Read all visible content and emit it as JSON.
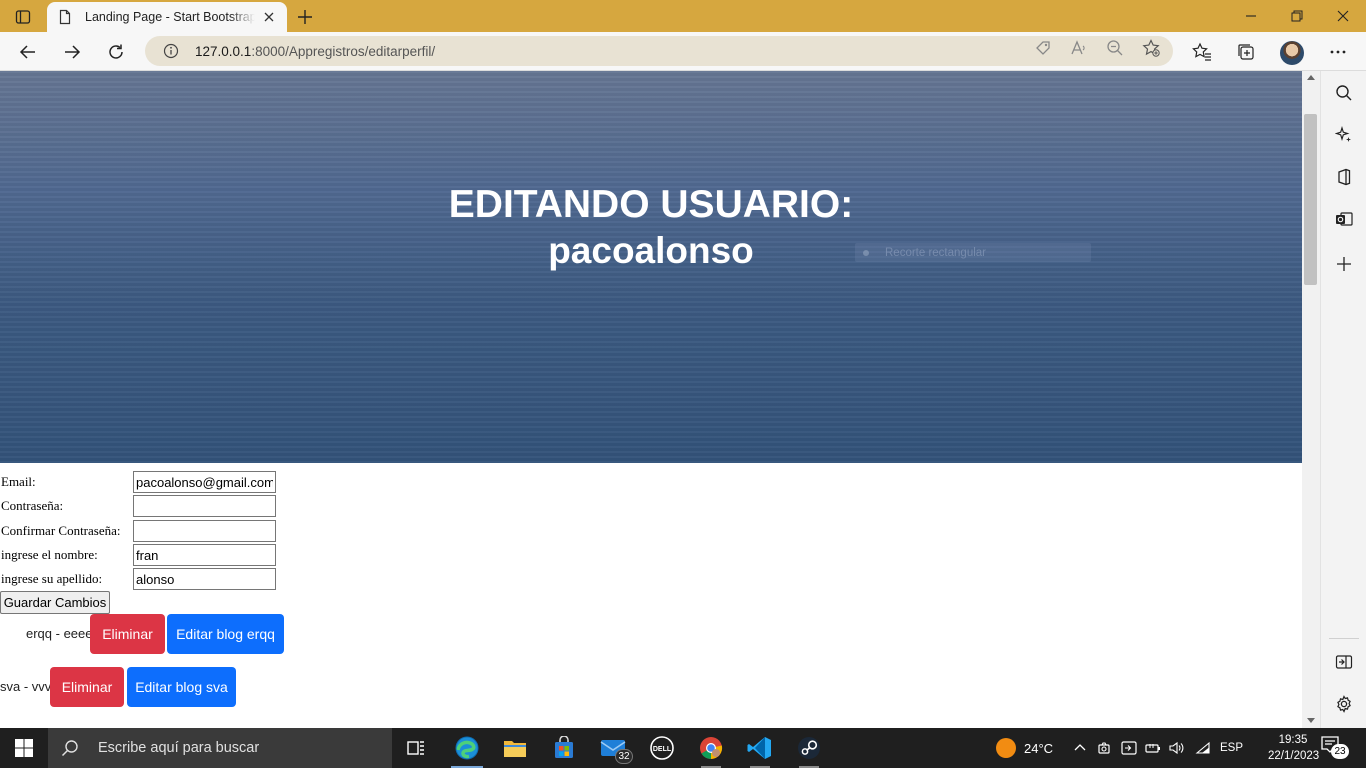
{
  "browser": {
    "tab_title": "Landing Page - Start Bootstrap Theme",
    "url_host": "127.0.0.1",
    "url_rest": ":8000/Appregistros/editarperfil/"
  },
  "page": {
    "hero_title": "EDITANDO USUARIO:",
    "hero_username": "pacoalonso",
    "snip_hint": "Recorte rectangular",
    "form": {
      "email_label": "Email:",
      "email_value": "pacoalonso@gmail.com",
      "password_label": "Contraseña:",
      "password_value": "",
      "confirm_label": "Confirmar Contraseña:",
      "confirm_value": "",
      "name_label": "ingrese el nombre:",
      "name_value": "fran",
      "lastname_label": "ingrese su apellido:",
      "lastname_value": "alonso",
      "save_label": "Guardar Cambios"
    },
    "blogs": [
      {
        "label": "erqq - eeee",
        "delete_label": "Eliminar",
        "edit_label": "Editar blog erqq"
      },
      {
        "label": "sva - vvv",
        "delete_label": "Eliminar",
        "edit_label": "Editar blog sva"
      }
    ]
  },
  "taskbar": {
    "search_placeholder": "Escribe aquí para buscar",
    "mail_badge": "32",
    "weather": "24°C",
    "language": "ESP",
    "time": "19:35",
    "date": "22/1/2023",
    "notifications": "23"
  },
  "colors": {
    "titlebar": "#d6a73f",
    "danger": "#dc3545",
    "primary": "#0d6efd"
  }
}
